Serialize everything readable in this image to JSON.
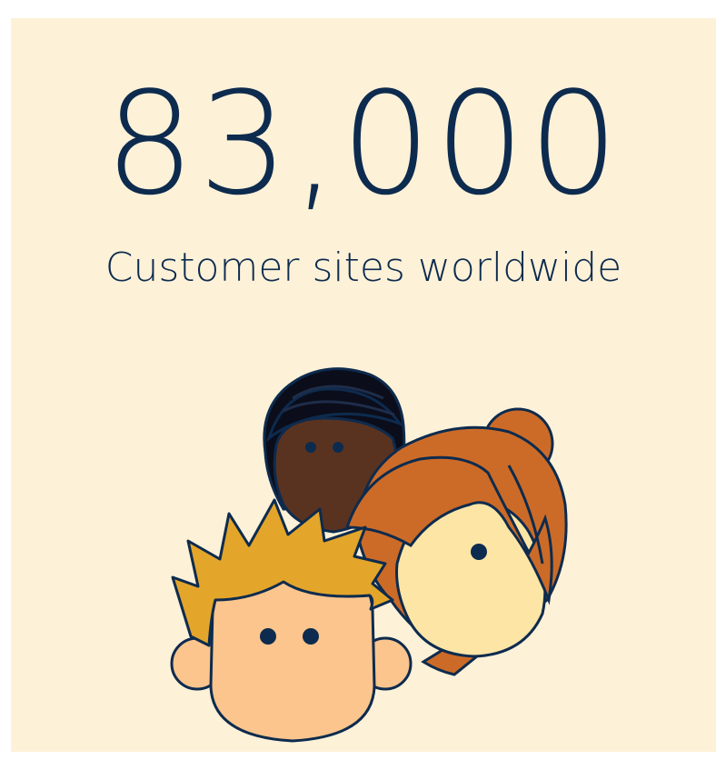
{
  "stat": {
    "value": "83,000",
    "caption": "Customer sites worldwide"
  },
  "colors": {
    "background": "#fdf1d8",
    "text": "#0d2b4e",
    "outline": "#0d2b4e",
    "hair_blond": "#e3a52a",
    "hair_red": "#cc6b27",
    "hair_black": "#0b0d1a",
    "skin_peach": "#fbc58d",
    "skin_light": "#fde5a6",
    "skin_dark": "#5a3320"
  },
  "illustration": {
    "icon": "people-group-icon",
    "figures": [
      "dark-skinned-person-icon",
      "red-haired-woman-icon",
      "blond-boy-icon"
    ]
  }
}
